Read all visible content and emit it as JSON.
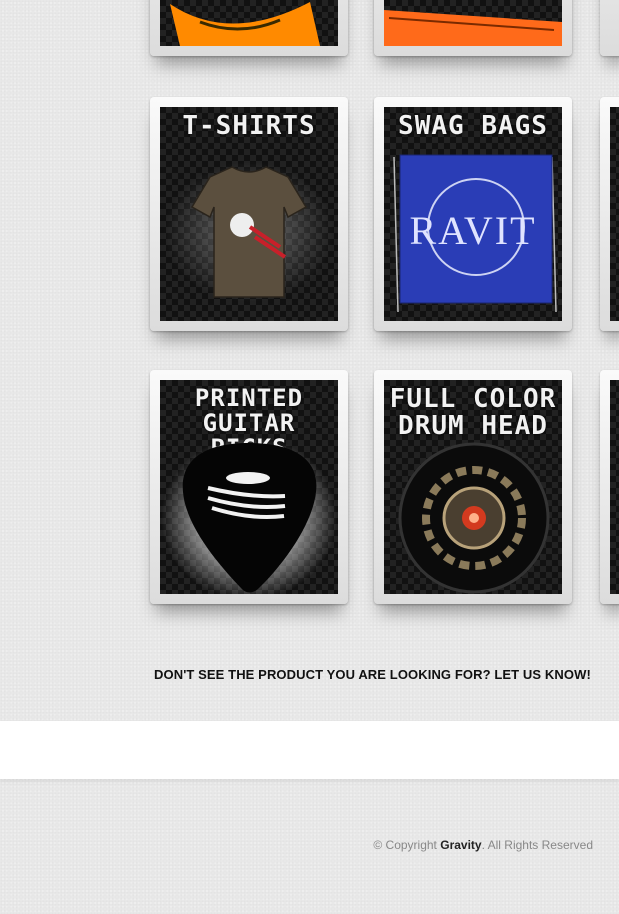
{
  "products": [
    {
      "title": "",
      "accent": "#ff8a00"
    },
    {
      "title": "",
      "accent": "#ff6a1a"
    },
    {
      "title": "T-SHIRTS",
      "accent": "#5b4f3e"
    },
    {
      "title": "SWAG BAGS",
      "accent": "#2a3db6"
    },
    {
      "title": "PRINTED\nGUITAR PICKS",
      "accent": "#000000"
    },
    {
      "title": "FULL COLOR\nDRUM HEAD",
      "accent": "#d33a1f"
    }
  ],
  "bag_print": "RAVIT",
  "cta": "DON'T SEE THE PRODUCT YOU ARE LOOKING FOR? LET US KNOW!",
  "footer": {
    "copyright_prefix": "© Copyright",
    "brand": "Gravity",
    "copyright_suffix": ". All Rights Reserved"
  }
}
